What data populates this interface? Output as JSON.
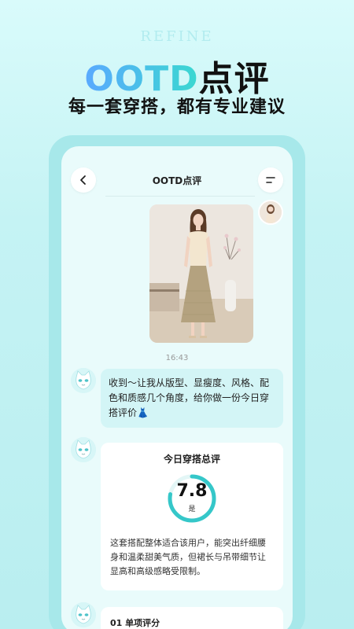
{
  "brand": "REFINE",
  "hero": {
    "title_latin": "OOTD",
    "title_cn": "点评",
    "subtitle": "每一套穿搭，都有专业建议"
  },
  "nav": {
    "title": "OOTD点评"
  },
  "chat": {
    "time": "16:43",
    "bot_message": "收到～让我从版型、显瘦度、风格、配色和质感几个角度，给你做一份今日穿搭评价👗",
    "summary_card": {
      "title": "今日穿搭总评",
      "score": "7.8",
      "score_suffix": "是",
      "score_fraction": 0.78,
      "text": "这套搭配整体适合该用户，能突出纤细腰身和温柔甜美气质，但裙长与吊带细节让显高和高级感略受限制。"
    },
    "section_card": {
      "title": "01 单项评分"
    }
  },
  "colors": {
    "accent": "#35c7c9",
    "bubble": "#d3f5f6",
    "gradient_start": "#5aa9ff",
    "gradient_end": "#3ad8d0"
  }
}
